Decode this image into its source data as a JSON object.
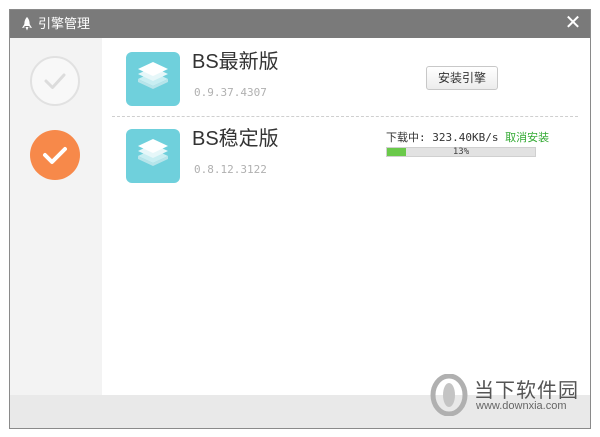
{
  "window": {
    "title": "引擎管理",
    "close_label": "✕"
  },
  "engines": [
    {
      "name": "BS最新版",
      "version": "0.9.37.4307",
      "action_label": "安装引擎"
    },
    {
      "name": "BS稳定版",
      "version": "0.8.12.3122",
      "download_status": "下载中: 323.40KB/s",
      "cancel_label": "取消安装",
      "progress_text": "13%",
      "progress_value": 0.13
    }
  ],
  "sidebar": {
    "steps": [
      {
        "state": "done"
      },
      {
        "state": "active"
      }
    ]
  },
  "watermark": {
    "name": "当下软件园",
    "url": "www.downxia.com"
  },
  "colors": {
    "accent_orange": "#f7894a",
    "progress_green": "#6ac94a",
    "icon_teal": "#6fd0dc",
    "titlebar_gray": "#7a7a7a",
    "link_green": "#33aa33"
  }
}
